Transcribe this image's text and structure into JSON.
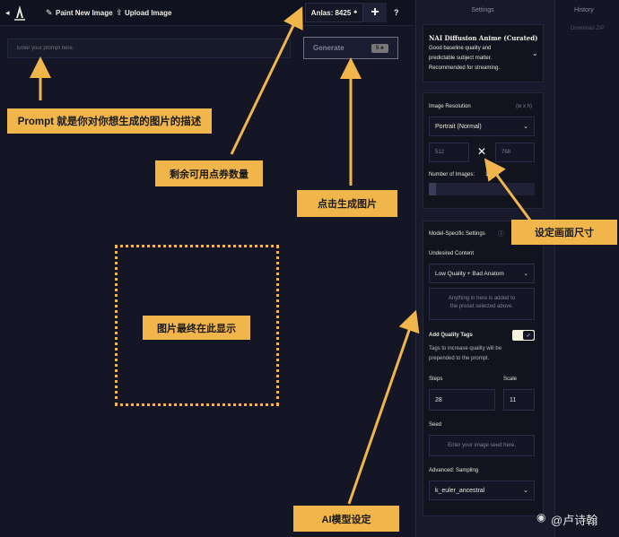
{
  "topbar": {
    "paint_label": "Paint New Image",
    "upload_label": "Upload Image",
    "anlas_label": "Anlas: 8425",
    "plus": "+",
    "help": "?"
  },
  "prompt": {
    "placeholder": "Enter your prompt here."
  },
  "generate": {
    "label": "Generate",
    "cost": "5"
  },
  "settings": {
    "title": "Settings",
    "model": {
      "name": "NAI Diffusion Anime (Curated)",
      "desc_line1": "Good baseline quality and",
      "desc_line2": "predictable subject matter.",
      "desc_line3": "Recommended for streaming."
    },
    "resolution": {
      "label": "Image Resolution",
      "unit": "(w x h)",
      "preset": "Portrait (Normal)",
      "width": "512",
      "height": "768",
      "times": "✕"
    },
    "num_images": {
      "label": "Number of Images:",
      "value": "1"
    },
    "model_specific": {
      "label": "Model-Specific Settings",
      "undesired_label": "Undesired Content",
      "undesired_value": "Low Quality + Bad Anatom",
      "undesired_hint_line1": "Anything in here is added to",
      "undesired_hint_line2": "the preset selected above.",
      "quality_tags_label": "Add Quality Tags",
      "quality_tags_on": true,
      "quality_desc_line1": "Tags to increase quality will be",
      "quality_desc_line2": "prepended to the prompt.",
      "steps_label": "Steps",
      "steps_value": "28",
      "scale_label": "Scale",
      "scale_value": "11",
      "seed_label": "Seed",
      "seed_placeholder": "Enter your image seed here.",
      "sampling_label": "Advanced: Sampling",
      "sampling_value": "k_euler_ancestral"
    }
  },
  "history": {
    "title": "History",
    "download": "Download ZIP"
  },
  "annotations": {
    "prompt_note": "Prompt 就是你对你想生成的图片的描述",
    "anlas_note": "剩余可用点券数量",
    "generate_note": "点击生成图片",
    "resolution_note": "设定画面尺寸",
    "display_note": "图片最终在此显示",
    "model_note": "AI模型设定"
  },
  "watermark": "@卢诗翰",
  "colors": {
    "accent": "#f0b64b",
    "background": "#141626",
    "panel": "#181a2c"
  }
}
